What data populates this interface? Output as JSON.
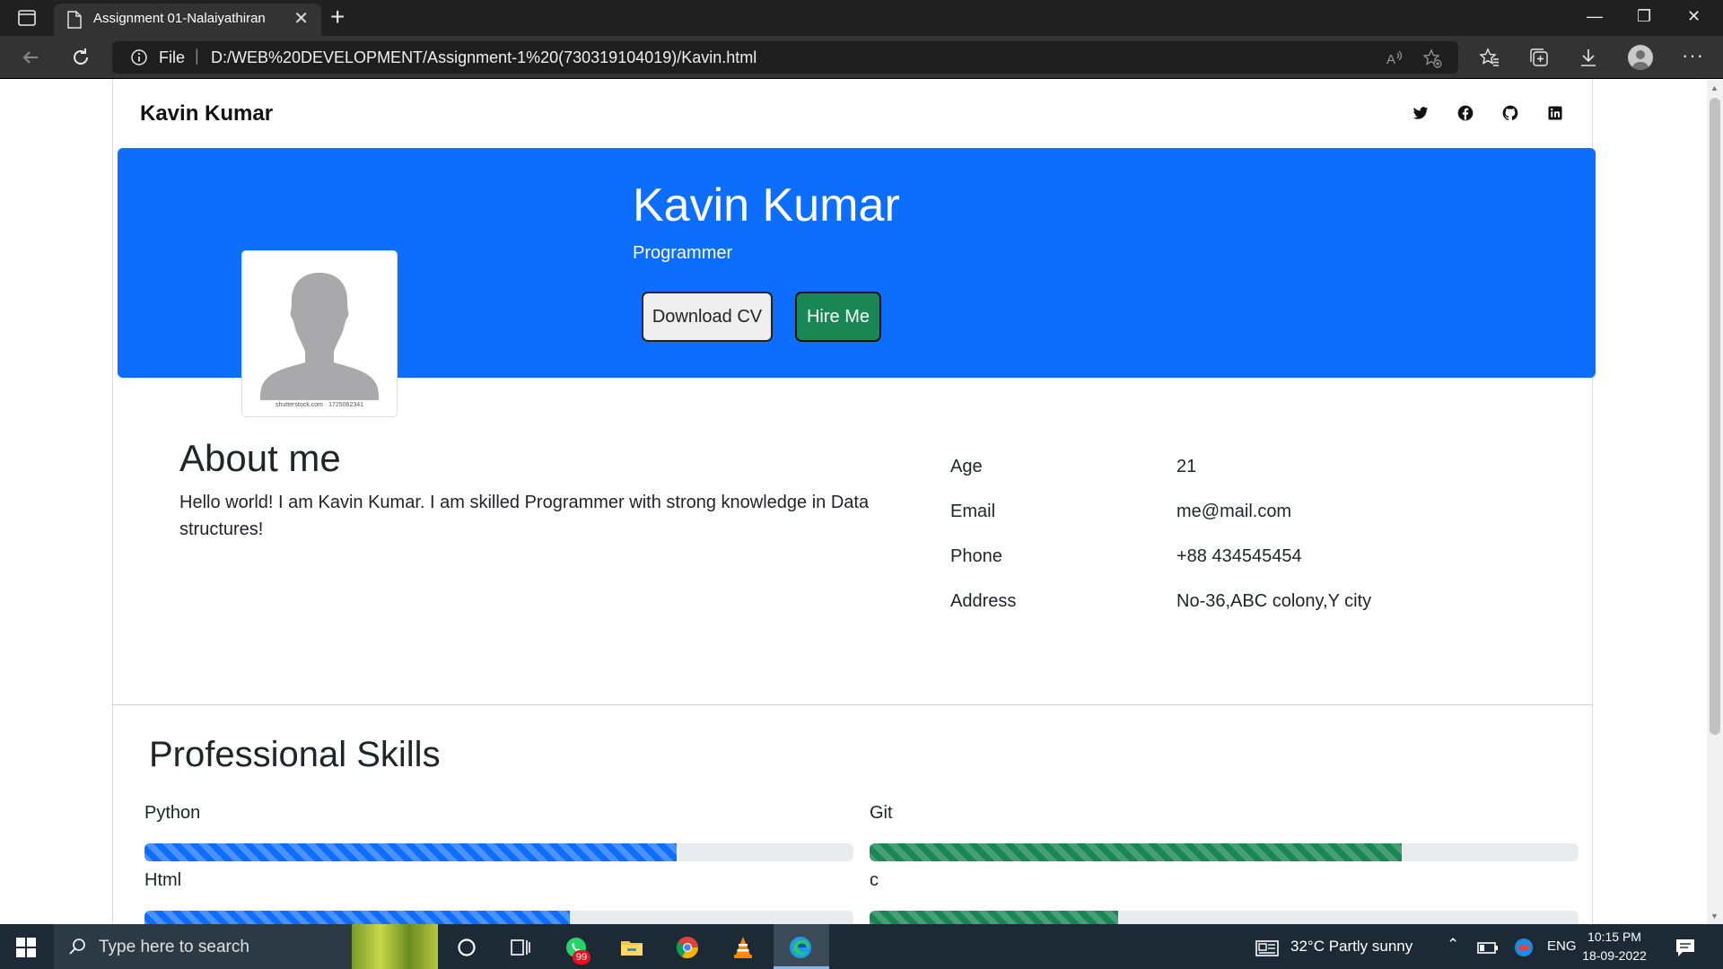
{
  "browser": {
    "tab_title": "Assignment 01-Nalaiyathiran",
    "tab_close": "✕",
    "new_tab": "+",
    "file_label": "File",
    "url": "D:/WEB%20DEVELOPMENT/Assignment-1%20(730319104019)/Kavin.html",
    "window_controls": {
      "minimize": "—",
      "restore": "❐",
      "close": "✕"
    },
    "more": "···"
  },
  "navbar": {
    "brand": "Kavin Kumar",
    "social_icons": [
      "twitter-icon",
      "facebook-icon",
      "github-icon",
      "linkedin-icon"
    ]
  },
  "hero": {
    "name": "Kavin Kumar",
    "role": "Programmer",
    "download_label": "Download CV",
    "hire_label": "Hire Me",
    "avatar_caption": "shutterstock.com · 1725062341"
  },
  "about": {
    "title": "About me",
    "text": "Hello world! I am Kavin Kumar. I am skilled Programmer with strong knowledge in Data structures!"
  },
  "info": [
    {
      "label": "Age",
      "value": "21"
    },
    {
      "label": "Email",
      "value": "me@mail.com"
    },
    {
      "label": "Phone",
      "value": "+88 434545454"
    },
    {
      "label": "Address",
      "value": "No-36,ABC colony,Y city"
    }
  ],
  "skills": {
    "title": "Professional Skills",
    "items": [
      {
        "name": "Python",
        "percent": 75,
        "color": "#0d6efd"
      },
      {
        "name": "Git",
        "percent": 75,
        "color": "#198754"
      },
      {
        "name": "Html",
        "percent": 60,
        "color": "#0d6efd"
      },
      {
        "name": "c",
        "percent": 35,
        "color": "#198754"
      }
    ]
  },
  "colors": {
    "hero_bg": "#0d6efd",
    "hire_button": "#198754",
    "taskbar": "#1c2a35"
  },
  "taskbar": {
    "search_placeholder": "Type here to search",
    "whatsapp_badge": "99",
    "weather": "32°C  Partly sunny",
    "language": "ENG",
    "time": "10:15 PM",
    "date": "18-09-2022"
  }
}
